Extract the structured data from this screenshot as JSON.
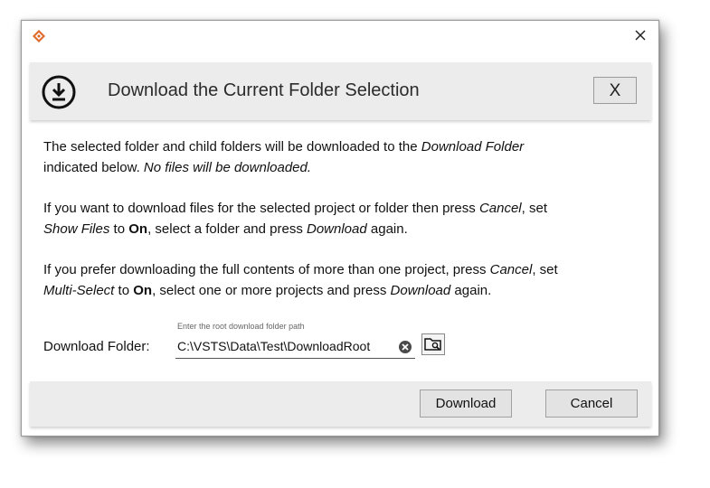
{
  "window": {
    "icon": "app-diamond-icon",
    "close_icon": "close-icon"
  },
  "header": {
    "icon": "download-circle-icon",
    "title": "Download the Current Folder Selection",
    "close_label": "X"
  },
  "body": {
    "paragraph1": {
      "t1": "The selected folder and child folders will be downloaded to the ",
      "i1": "Download Folder",
      "t2": "indicated below. ",
      "i2": "No files will be downloaded."
    },
    "paragraph2": {
      "t1": "If you want to download files for the selected project or folder then press ",
      "i1": "Cancel",
      "t2": ", set",
      "i2": "Show Files",
      "t3": " to ",
      "b1": "On",
      "t4": ", select a folder and press ",
      "i3": "Download",
      "t5": " again."
    },
    "paragraph3": {
      "t1": "If you prefer downloading the full contents of more than one project, press ",
      "i1": "Cancel",
      "t2": ", set",
      "i2": "Multi-Select",
      "t3": " to ",
      "b1": "On",
      "t4": ", select one or more projects and press ",
      "i3": "Download",
      "t5": " again."
    }
  },
  "download_folder": {
    "label": "Download Folder:",
    "hint": "Enter the root download folder path",
    "value": "C:\\VSTS\\Data\\Test\\DownloadRoot",
    "clear_icon": "clear-circle-icon",
    "browse_icon": "folder-search-icon"
  },
  "footer": {
    "download_label": "Download",
    "cancel_label": "Cancel"
  },
  "colors": {
    "app_icon": "#e06a2c",
    "panel_bg": "#ececec",
    "button_bg": "#e3e3e3"
  }
}
